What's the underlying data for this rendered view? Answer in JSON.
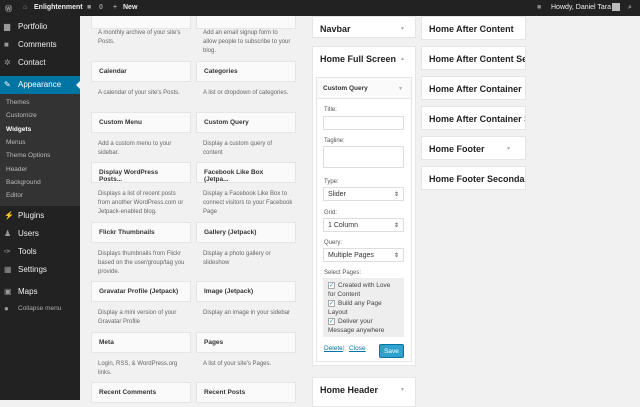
{
  "adminbar": {
    "site": "Enlightenment",
    "comments": "0",
    "new": "New",
    "howdy": "Howdy, Daniel Tara"
  },
  "sidebar": {
    "items": [
      {
        "label": "Portfolio",
        "icon": "portfolio-icon"
      },
      {
        "label": "Comments",
        "icon": "comments-icon"
      },
      {
        "label": "Contact",
        "icon": "contact-icon"
      },
      {
        "label": "Appearance",
        "icon": "appearance-icon"
      },
      {
        "label": "Plugins",
        "icon": "plugins-icon"
      },
      {
        "label": "Users",
        "icon": "users-icon"
      },
      {
        "label": "Tools",
        "icon": "tools-icon"
      },
      {
        "label": "Settings",
        "icon": "settings-icon"
      },
      {
        "label": "Maps",
        "icon": "maps-icon"
      },
      {
        "label": "Collapse menu",
        "icon": "collapse-icon"
      }
    ],
    "submenu": [
      "Themes",
      "Customize",
      "Widgets",
      "Menus",
      "Theme Options",
      "Header",
      "Background",
      "Editor"
    ]
  },
  "widgets": {
    "top_descs": [
      "A monthly archive of your site's Posts.",
      "Add an email signup form to allow people to subscribe to your blog."
    ],
    "items": [
      {
        "title": "Calendar",
        "desc": "A calendar of your site's Posts."
      },
      {
        "title": "Categories",
        "desc": "A list or dropdown of categories."
      },
      {
        "title": "Custom Menu",
        "desc": "Add a custom menu to your sidebar."
      },
      {
        "title": "Custom Query",
        "desc": "Display a custom query of content"
      },
      {
        "title": "Display WordPress Posts...",
        "desc": "Displays a list of recent posts from another WordPress.com or Jetpack-enabled blog."
      },
      {
        "title": "Facebook Like Box (Jetpa...",
        "desc": "Display a Facebook Like Box to connect visitors to your Facebook Page"
      },
      {
        "title": "Flickr Thumbnails",
        "desc": "Displays thumbnails from Flickr based on the user/group/tag you provide."
      },
      {
        "title": "Gallery (Jetpack)",
        "desc": "Display a photo gallery or slideshow"
      },
      {
        "title": "Gravatar Profile (Jetpack)",
        "desc": "Display a mini version of your Gravatar Profile"
      },
      {
        "title": "Image (Jetpack)",
        "desc": "Display an image in your sidebar"
      },
      {
        "title": "Meta",
        "desc": "Login, RSS, & WordPress.org links."
      },
      {
        "title": "Pages",
        "desc": "A list of your site's Pages."
      },
      {
        "title": "Recent Comments",
        "desc": ""
      },
      {
        "title": "Recent Posts",
        "desc": ""
      }
    ]
  },
  "areas": {
    "navbar": "Navbar",
    "full": "Home Full Screen",
    "header": "Home Header",
    "right": [
      "Home After Content",
      "Home After Content Se",
      "Home After Container",
      "Home After Container S",
      "Home Footer",
      "Home Footer Secondar"
    ]
  },
  "form": {
    "widget": "Custom Query",
    "title_label": "Title:",
    "title_value": "",
    "tagline_label": "Tagline:",
    "tagline_value": "",
    "type_label": "Type:",
    "type_value": "Slider",
    "grid_label": "Grid:",
    "grid_value": "1 Column",
    "query_label": "Query:",
    "query_value": "Multiple Pages",
    "pages_label": "Select Pages:",
    "pages": [
      {
        "label": "Created with Love for Content",
        "checked": true
      },
      {
        "label": "Build any Page Layout",
        "checked": true
      },
      {
        "label": "Deliver your Message anywhere",
        "checked": true
      }
    ],
    "delete": "Delete",
    "sep": "|",
    "close": "Close",
    "save": "Save"
  },
  "colors": {
    "accent": "#0074a2",
    "button": "#2ea2cc"
  }
}
